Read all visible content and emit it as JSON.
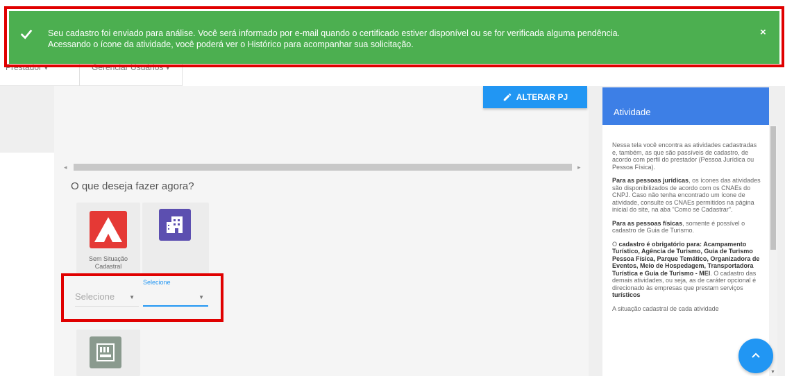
{
  "notification": {
    "line1": "Seu cadastro foi enviado para análise. Você será informado por e-mail quando o certificado estiver disponível ou se for verificada alguma pendência.",
    "line2": "Acessando o ícone da atividade, você poderá ver o Histórico para acompanhar sua solicitação.",
    "close_label": "×",
    "icon": "check-icon",
    "color": "#4caf50"
  },
  "nav": {
    "items": [
      {
        "label": "Prestador"
      },
      {
        "label": "Gerenciar Usuários"
      }
    ]
  },
  "toolbar": {
    "alterar_label": "ALTERAR PJ",
    "alterar_icon": "pencil-icon"
  },
  "main": {
    "question": "O que deseja fazer agora?",
    "cards": [
      {
        "icon": "tent-icon",
        "label_line1": "Sem Situação",
        "label_line2": "Cadastral",
        "color": "#e53935"
      },
      {
        "icon": "hotel-icon",
        "label_line1": "",
        "label_line2": "",
        "color": "#5c4fb0"
      },
      {
        "icon": "guide-icon",
        "label_line1": "",
        "label_line2": "",
        "color": "#8a9a8e"
      }
    ],
    "select1": {
      "value": "Selecione"
    },
    "select2": {
      "label": "Selecione",
      "value": ""
    }
  },
  "side_panel": {
    "title": "Atividade",
    "p1": "Nessa tela você encontra as atividades cadastradas e, também, as que são passíveis de cadastro, de acordo com perfil do prestador (Pessoa Jurídica ou Pessoa Física).",
    "p2_bold": "Para as pessoas jurídicas",
    "p2_rest": ", os ícones das atividades são disponibilizados de acordo com os CNAEs do CNPJ. Caso não tenha encontrado um ícone de atividade, consulte os CNAEs permitidos na página inicial do site, na aba \"Como se Cadastrar\".",
    "p3_bold": "Para as pessoas físicas",
    "p3_rest": ", somente é possível o cadastro de Guia de Turismo.",
    "p4_pre": "O ",
    "p4_bold": "cadastro é obrigatório para: Acampamento Turístico, Agência de Turismo, Guia de Turismo Pessoa Física, Parque Temático, Organizadora de Eventos, Meio de Hospedagem, Transportadora Turística e Guia de Turismo - MEI",
    "p4_rest": ". O cadastro das demais atividades, ou seja, as de caráter opcional é direcionado às empresas que prestam serviços ",
    "p4_bold2": "turísticos",
    "p5": "A situação cadastral de cada atividade"
  },
  "colors": {
    "accent": "#2196f3",
    "side_header": "#3d7fe6",
    "highlight": "#e00000"
  }
}
